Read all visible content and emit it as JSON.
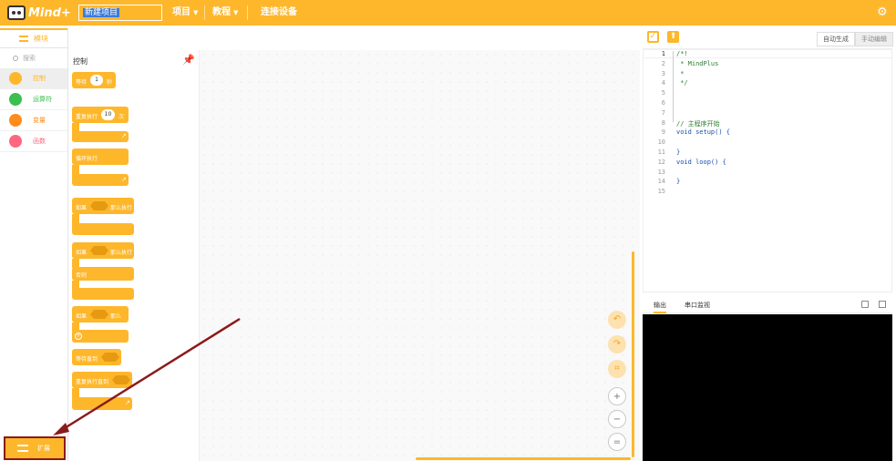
{
  "topbar": {
    "logo_text": "Mind+",
    "project_name": "新建项目",
    "menu": [
      {
        "label": "项目"
      },
      {
        "label": "教程"
      },
      {
        "label": "连接设备"
      }
    ],
    "settings_icon": "gear-icon"
  },
  "sidebar": {
    "tab_label": "模块",
    "search_placeholder": "搜索",
    "categories": [
      {
        "label": "控制",
        "color": "#FEB72B",
        "active": true
      },
      {
        "label": "运算符",
        "color": "#3BBF4F",
        "active": false
      },
      {
        "label": "变量",
        "color": "#FF8C1A",
        "active": false
      },
      {
        "label": "函数",
        "color": "#FF6680",
        "active": false
      }
    ],
    "extension_label": "扩展"
  },
  "palette": {
    "title": "控制",
    "blocks": {
      "wait": {
        "label": "等待",
        "value": "1",
        "unit": "秒"
      },
      "repeat": {
        "label": "重复执行",
        "value": "10",
        "unit": "次"
      },
      "forever": {
        "label": "循环执行"
      },
      "if_then": {
        "label": "如果",
        "suffix": "那么执行"
      },
      "if_else": {
        "label": "如果",
        "suffix": "那么执行",
        "else_label": "否则"
      },
      "if_mutator": {
        "label": "如果",
        "suffix": "那么"
      },
      "wait_until": {
        "label": "等待直到"
      },
      "repeat_until": {
        "label": "重复执行直到"
      }
    }
  },
  "code_panel": {
    "modes": [
      {
        "label": "自动生成",
        "active": true
      },
      {
        "label": "手动编辑",
        "active": false
      }
    ],
    "lines": [
      {
        "n": "1",
        "text": "/*!",
        "cls": "cm"
      },
      {
        "n": "2",
        "text": " * MindPlus",
        "cls": "cm"
      },
      {
        "n": "3",
        "text": " *",
        "cls": "cm"
      },
      {
        "n": "4",
        "text": " */",
        "cls": "cm"
      },
      {
        "n": "5",
        "text": "",
        "cls": ""
      },
      {
        "n": "6",
        "text": "",
        "cls": ""
      },
      {
        "n": "7",
        "text": "",
        "cls": ""
      },
      {
        "n": "8",
        "text": "// 主程序开始",
        "cls": "cm"
      },
      {
        "n": "9",
        "text": "void setup() {",
        "cls": "kw"
      },
      {
        "n": "10",
        "text": "",
        "cls": ""
      },
      {
        "n": "11",
        "text": "}",
        "cls": "kw"
      },
      {
        "n": "12",
        "text": "void loop() {",
        "cls": "kw"
      },
      {
        "n": "13",
        "text": "",
        "cls": ""
      },
      {
        "n": "14",
        "text": "}",
        "cls": "kw"
      },
      {
        "n": "15",
        "text": "",
        "cls": ""
      }
    ]
  },
  "output": {
    "tabs": [
      {
        "label": "输出",
        "active": true
      },
      {
        "label": "串口监视",
        "active": false
      }
    ]
  },
  "colors": {
    "accent": "#FEB72B",
    "annotation": "#8B1A1A"
  }
}
